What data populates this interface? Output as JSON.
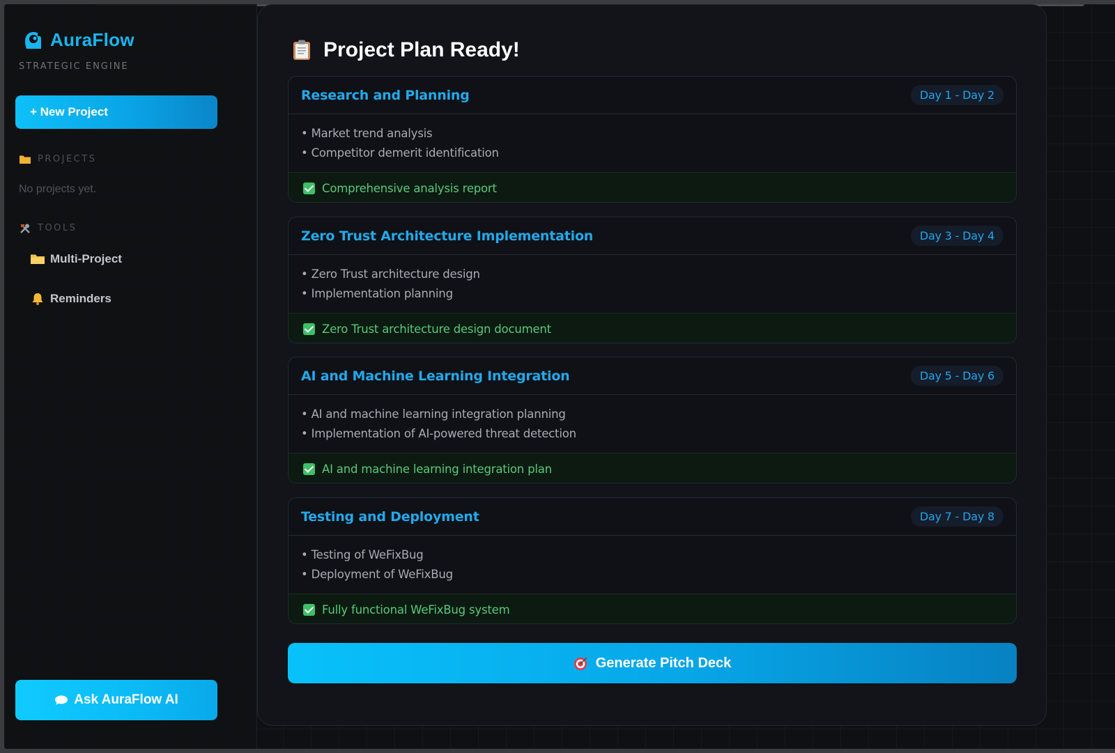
{
  "sidebar": {
    "brand_name": "AuraFlow",
    "brand_subtitle": "STRATEGIC ENGINE",
    "new_project_label": "+ New Project",
    "projects_heading": "PROJECTS",
    "projects_empty": "No projects yet.",
    "tools_heading": "TOOLS",
    "tools": [
      {
        "label": "Multi-Project",
        "icon": "folder-icon"
      },
      {
        "label": "Reminders",
        "icon": "bell-icon"
      }
    ],
    "ask_ai_label": "Ask AuraFlow AI"
  },
  "main": {
    "title": "Project Plan Ready!",
    "phases": [
      {
        "title": "Research and Planning",
        "days": "Day 1 - Day 2",
        "tasks": [
          "• Market trend analysis",
          "• Competitor demerit identification"
        ],
        "deliverable": "Comprehensive analysis report"
      },
      {
        "title": "Zero Trust Architecture Implementation",
        "days": "Day 3 - Day 4",
        "tasks": [
          "• Zero Trust architecture design",
          "• Implementation planning"
        ],
        "deliverable": "Zero Trust architecture design document"
      },
      {
        "title": "AI and Machine Learning Integration",
        "days": "Day 5 - Day 6",
        "tasks": [
          "• AI and machine learning integration planning",
          "• Implementation of AI-powered threat detection"
        ],
        "deliverable": "AI and machine learning integration plan"
      },
      {
        "title": "Testing and Deployment",
        "days": "Day 7 - Day 8",
        "tasks": [
          "• Testing of WeFixBug",
          "• Deployment of WeFixBug"
        ],
        "deliverable": "Fully functional WeFixBug system"
      }
    ],
    "pitch_button_label": "Generate Pitch Deck"
  },
  "colors": {
    "accent": "#19b5f0",
    "button_gradient_start": "#0ec0f8",
    "button_gradient_end": "#0a86c9",
    "deliverable_green": "#58c97a",
    "background": "#0f1013"
  }
}
